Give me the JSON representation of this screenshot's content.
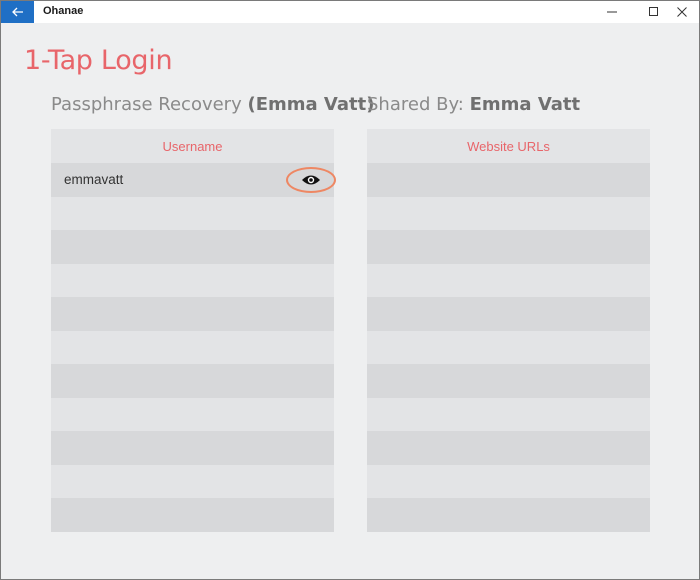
{
  "window": {
    "app_title": "Ohanae",
    "back_icon": "arrow-left-icon",
    "controls": [
      "minimize-icon",
      "maximize-icon",
      "close-icon"
    ]
  },
  "page": {
    "title": "1-Tap Login"
  },
  "left_section": {
    "title_prefix": "Passphrase Recovery",
    "title_name": "(Emma Vatt)",
    "column_header": "Username",
    "rows": [
      "emmavatt",
      "",
      "",
      "",
      "",
      "",
      "",
      "",
      "",
      "",
      ""
    ],
    "reveal_icon": "eye-icon"
  },
  "right_section": {
    "title_prefix": "Shared By:",
    "title_name": "Emma Vatt",
    "column_header": "Website URLs",
    "rows": [
      "",
      "",
      "",
      "",
      "",
      "",
      "",
      "",
      "",
      "",
      ""
    ]
  },
  "colors": {
    "accent": "#e8656a",
    "titlebar_back": "#1f6fc5",
    "highlight_ring": "#ee8763"
  }
}
